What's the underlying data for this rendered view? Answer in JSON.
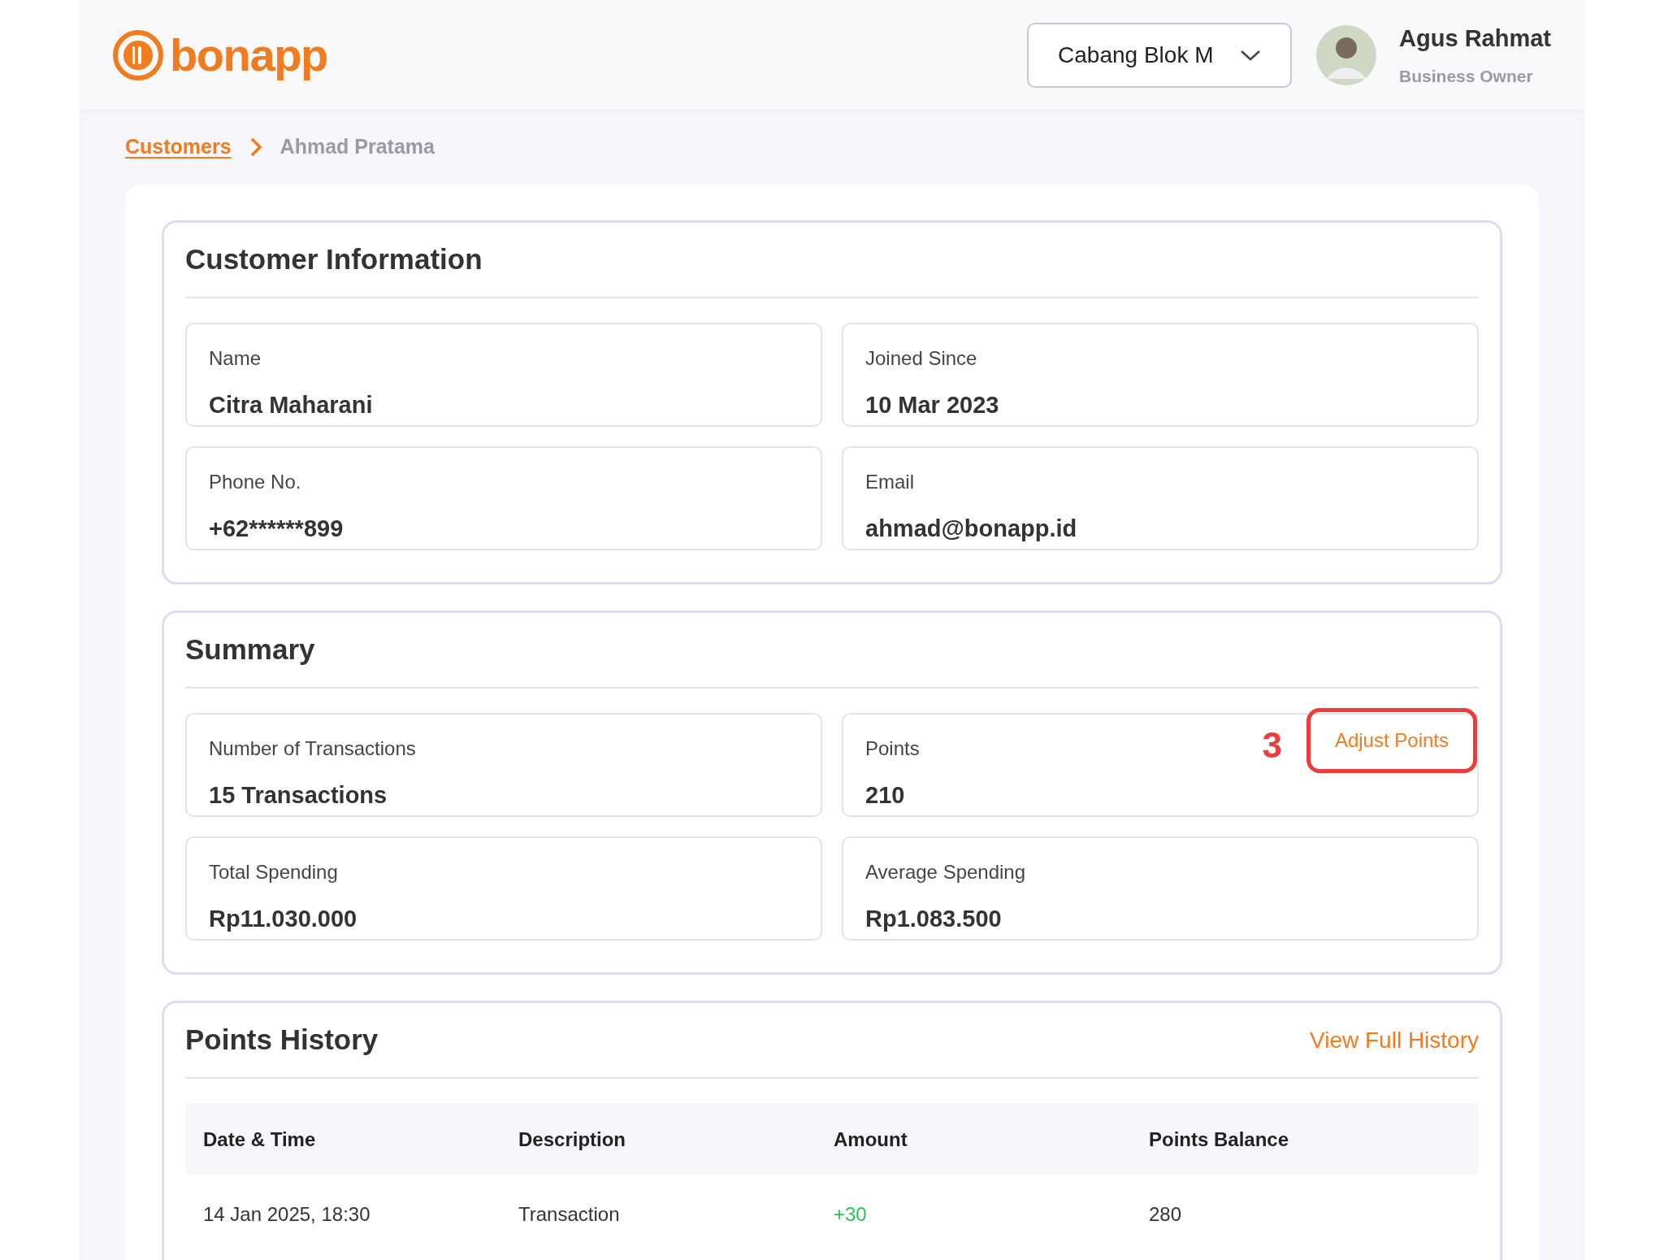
{
  "header": {
    "logo": "bonapp",
    "branch_selector": {
      "value": "Cabang Blok M"
    },
    "user": {
      "name": "Agus Rahmat",
      "role": "Business Owner"
    }
  },
  "breadcrumb": [
    {
      "label": "Customers",
      "kind": "link"
    },
    {
      "label": "Ahmad Pratama",
      "kind": "current"
    }
  ],
  "sections": [
    {
      "title": "Customer Information",
      "fields": [
        {
          "label": "Name",
          "value": "Citra Maharani"
        },
        {
          "label": "Joined Since",
          "value": "10 Mar 2023"
        },
        {
          "label": "Phone No.",
          "value": "+62******899"
        },
        {
          "label": "Email",
          "value": "ahmad@bonapp.id"
        }
      ]
    },
    {
      "title": "Summary",
      "fields": [
        {
          "label": "Number of Transactions",
          "value": "15 Transactions"
        },
        {
          "label": "Points",
          "value": "210",
          "action": {
            "label": "Adjust Points",
            "annotation": "3"
          }
        },
        {
          "label": "Total Spending",
          "value": "Rp11.030.000"
        },
        {
          "label": "Average Spending",
          "value": "Rp1.083.500"
        }
      ]
    }
  ],
  "points_history": {
    "title": "Points History",
    "action": "View Full History",
    "columns": [
      "Date & Time",
      "Description",
      "Amount",
      "Points Balance"
    ],
    "rows": [
      {
        "date_time": "14 Jan 2025, 18:30",
        "description": "Transaction",
        "amount": "+30",
        "points_balance": "280",
        "positive": true
      }
    ]
  }
}
